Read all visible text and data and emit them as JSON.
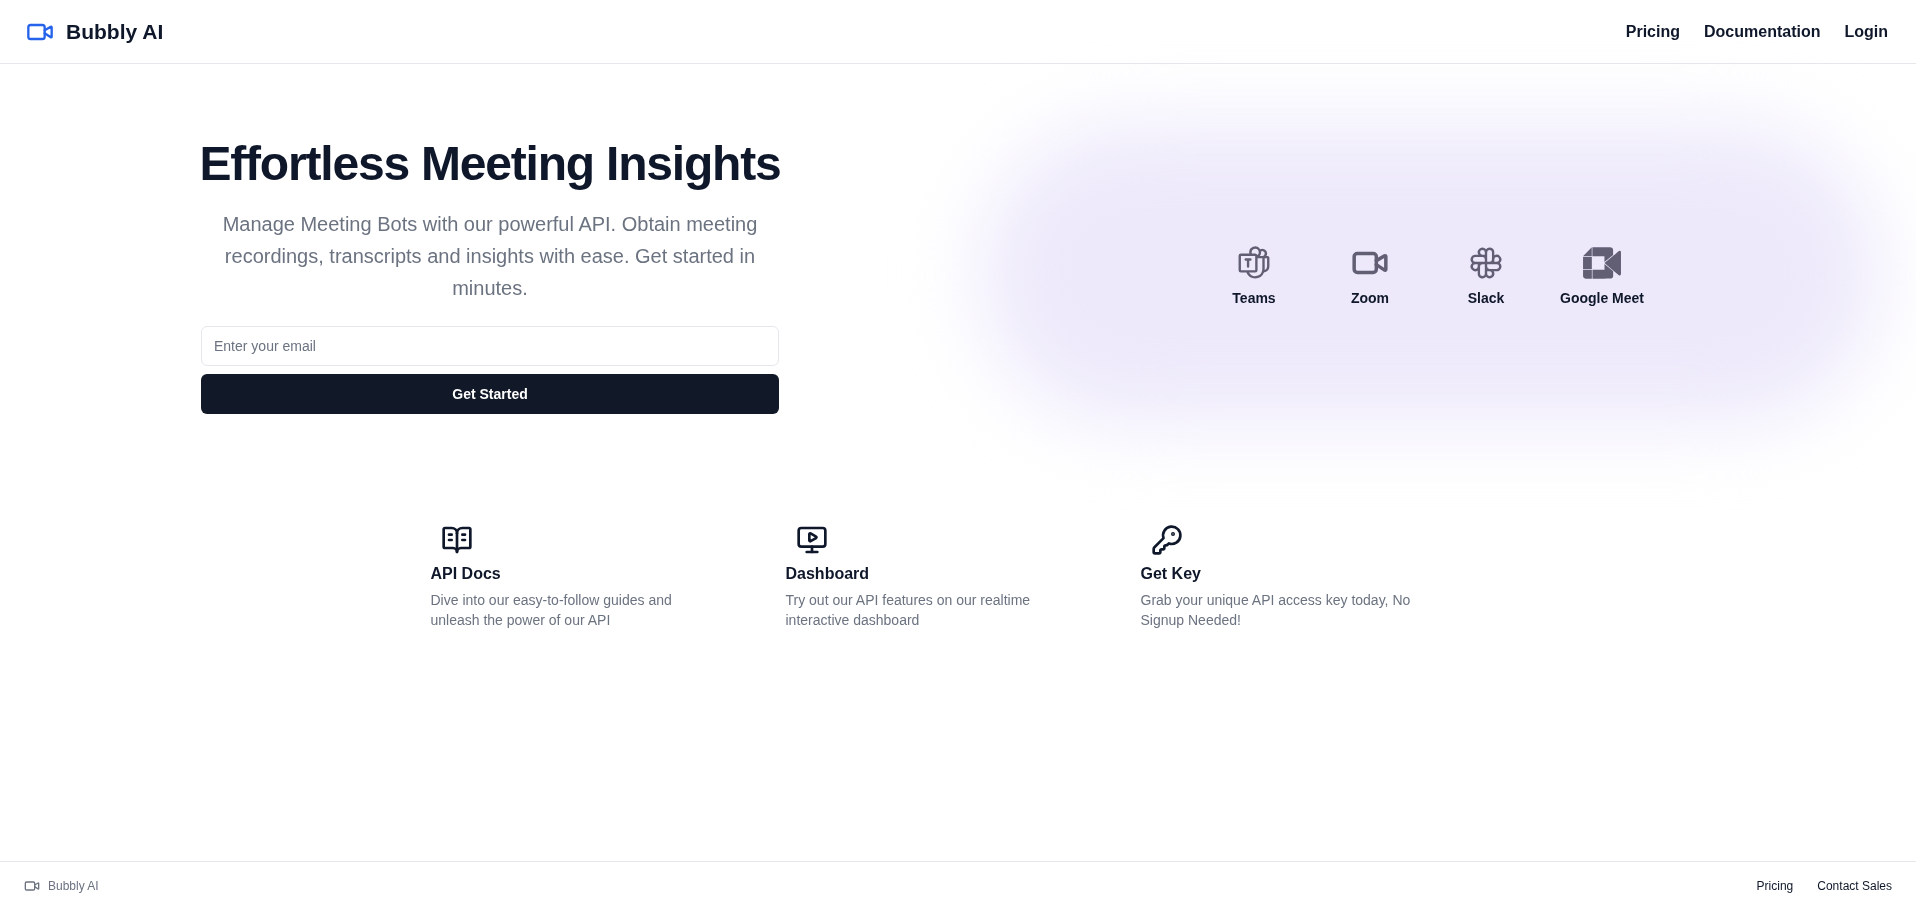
{
  "header": {
    "brand": "Bubbly AI",
    "nav": [
      "Pricing",
      "Documentation",
      "Login"
    ]
  },
  "hero": {
    "title": "Effortless Meeting Insights",
    "subtitle": "Manage Meeting Bots with our powerful API. Obtain meeting recordings, transcripts and insights with ease. Get started in minutes.",
    "email": {
      "placeholder": "Enter your email"
    },
    "button": "Get Started"
  },
  "integrations": [
    {
      "label": "Teams"
    },
    {
      "label": "Zoom"
    },
    {
      "label": "Slack"
    },
    {
      "label": "Google Meet"
    }
  ],
  "features": [
    {
      "title": "API Docs",
      "description": "Dive into our easy-to-follow guides and unleash the power of our API"
    },
    {
      "title": "Dashboard",
      "description": "Try out our API features on our realtime interactive dashboard"
    },
    {
      "title": "Get Key",
      "description": "Grab your unique API access key today, No Signup Needed!"
    }
  ],
  "footer": {
    "brand": "Bubbly AI",
    "links": [
      "Pricing",
      "Contact Sales"
    ]
  }
}
